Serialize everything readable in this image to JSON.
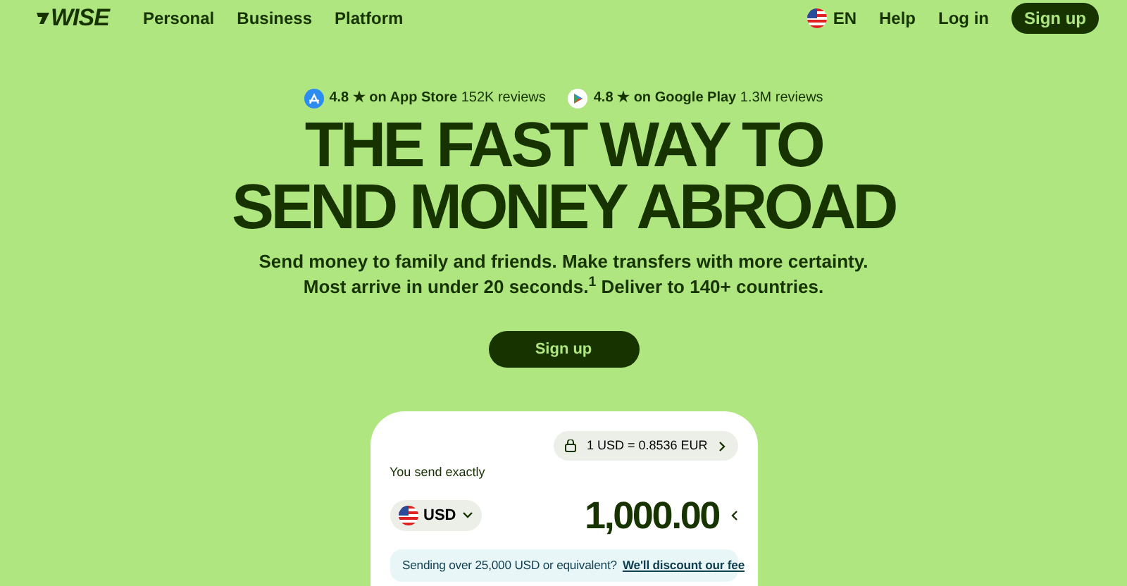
{
  "nav": {
    "logo": "WISE",
    "links": [
      "Personal",
      "Business",
      "Platform"
    ],
    "language": "EN",
    "help": "Help",
    "login": "Log in",
    "signup": "Sign up"
  },
  "ratings": [
    {
      "kind": "appstore",
      "score": "4.8 ★ on App Store",
      "reviews": "152K reviews"
    },
    {
      "kind": "googleplay",
      "score": "4.8 ★ on Google Play",
      "reviews": "1.3M reviews"
    }
  ],
  "hero": {
    "headline": [
      "THE FAST WAY TO",
      "SEND MONEY ABROAD"
    ],
    "subtitle": [
      "Send money to family and friends. Make transfers with more certainty.",
      "Most arrive in under 20 seconds.$^{1}$ Deliver to 140+ countries."
    ],
    "cta": "Sign up"
  },
  "calculator": {
    "rate": "1 USD = 0.8536 EUR",
    "send_label": "You send exactly",
    "currency": "USD",
    "amount": "1,000.00",
    "notice": "Sending over 25,000 USD or equivalent?",
    "notice_link": "We'll discount our fee"
  }
}
